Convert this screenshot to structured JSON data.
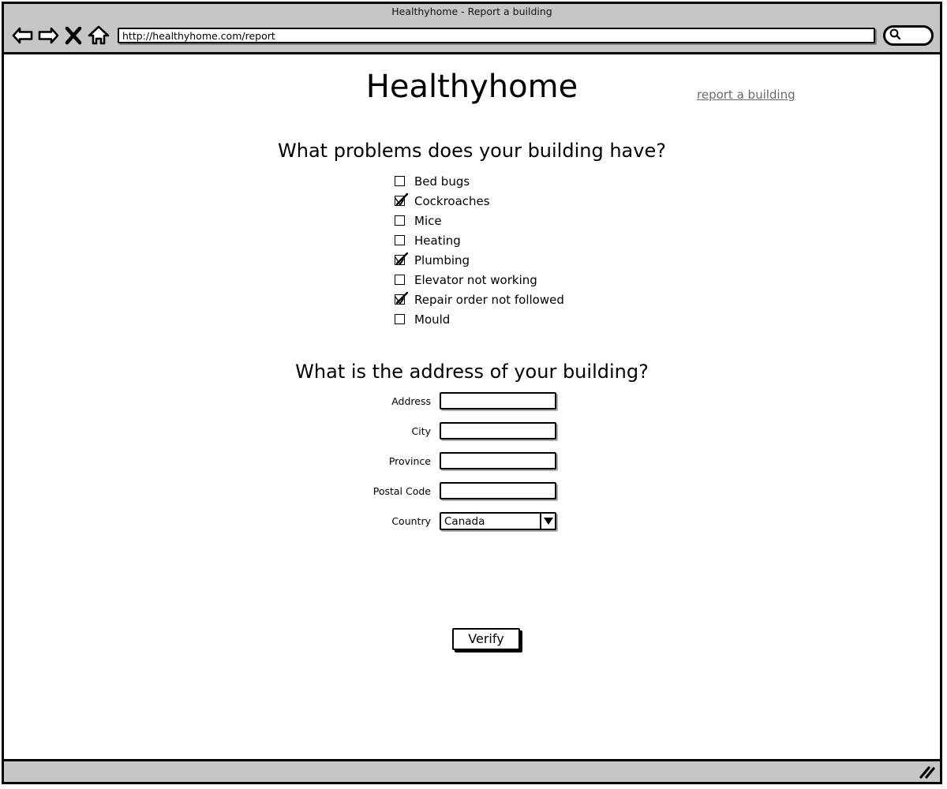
{
  "window": {
    "title": "Healthyhome - Report a building",
    "toolbar": {
      "back_icon": "back-arrow-icon",
      "forward_icon": "forward-arrow-icon",
      "stop_icon": "stop-x-icon",
      "home_icon": "home-icon",
      "search_icon": "search-icon",
      "url": "http://healthyhome.com/report",
      "url_placeholder": "",
      "search_value": "",
      "search_placeholder": ""
    },
    "status": {
      "resize_grip_icon": "resize-grip-icon"
    }
  },
  "page": {
    "site_title": "Healthyhome",
    "header_link": "report a building",
    "problems": {
      "heading": "What problems does your building have?",
      "items": [
        {
          "label": "Bed bugs",
          "checked": false
        },
        {
          "label": "Cockroaches",
          "checked": true
        },
        {
          "label": "Mice",
          "checked": false
        },
        {
          "label": "Heating",
          "checked": false
        },
        {
          "label": "Plumbing",
          "checked": true
        },
        {
          "label": "Elevator not working",
          "checked": false
        },
        {
          "label": "Repair order not followed",
          "checked": true
        },
        {
          "label": "Mould",
          "checked": false
        }
      ]
    },
    "address": {
      "heading": "What is the address of your building?",
      "fields": [
        {
          "label": "Address",
          "value": "",
          "placeholder": ""
        },
        {
          "label": "City",
          "value": "",
          "placeholder": ""
        },
        {
          "label": "Province",
          "value": "",
          "placeholder": ""
        },
        {
          "label": "Postal Code",
          "value": "",
          "placeholder": ""
        }
      ],
      "country": {
        "label": "Country",
        "value": "Canada",
        "arrow_icon": "chevron-down-icon"
      }
    },
    "verify_label": "Verify"
  },
  "colors": {
    "chrome": "#c6c6c6",
    "ink": "#000000",
    "link": "#6b6b6b",
    "page_bg": "#ffffff"
  }
}
